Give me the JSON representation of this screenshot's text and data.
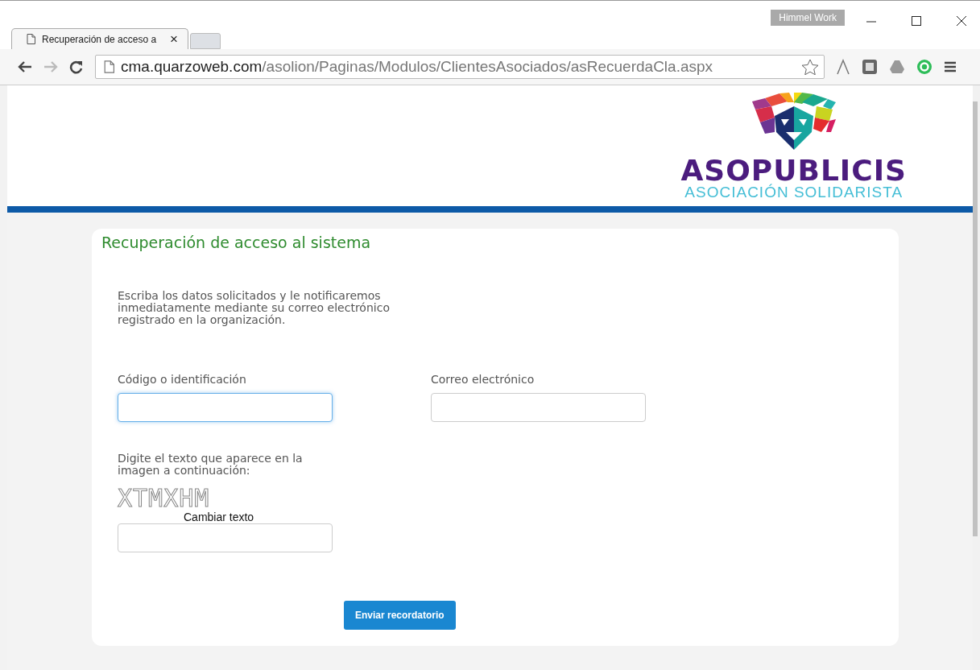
{
  "window": {
    "profile": "Himmel Work"
  },
  "tabs": [
    {
      "title": "Recuperación de acceso a",
      "close": "×",
      "selected": true
    }
  ],
  "address_bar": {
    "domain": "cma.quarzoweb.com",
    "path": "/asolion/Paginas/Modulos/ClientesAsociados/asRecuerdaCla.aspx"
  },
  "header": {
    "brand": "ASOPUBLICIS",
    "tagline": "ASOCIACIÓN SOLIDARISTA"
  },
  "form": {
    "title": "Recuperación de acceso al sistema",
    "intro": "Escriba los datos solicitados y le notificaremos inmediatamente mediante su correo electrónico registrado en la organización.",
    "fields": [
      {
        "label": "Código o identificación",
        "focused": true
      },
      {
        "label": "Correo electrónico",
        "focused": false
      }
    ],
    "captcha_label": "Digite el texto que aparece en la imagen a continuación:",
    "captcha_text": "XTMXHM",
    "captcha_link": "Cambiar texto",
    "captcha_field": {
      "focused": false
    },
    "submit": "Enviar recordatorio"
  }
}
